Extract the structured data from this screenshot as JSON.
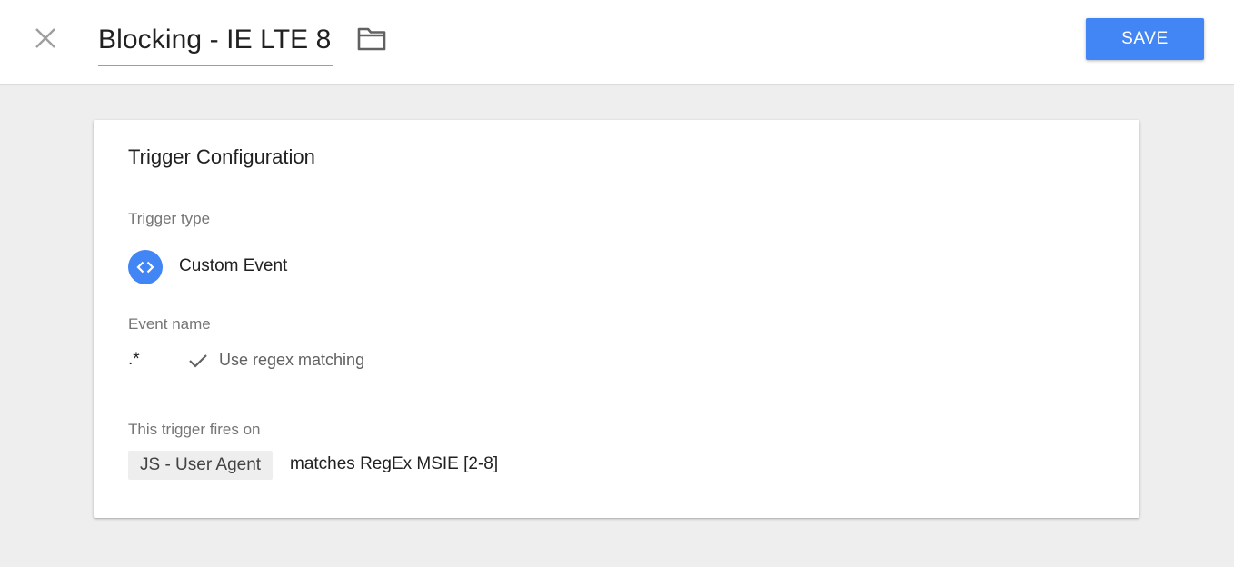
{
  "header": {
    "title": "Blocking - IE LTE 8",
    "save_label": "SAVE",
    "close_icon": "close-icon",
    "folder_icon": "folder-icon",
    "accent_color": "#4285f4"
  },
  "card": {
    "title": "Trigger Configuration",
    "trigger_type": {
      "label": "Trigger type",
      "value": "Custom Event",
      "icon": "code-brackets-icon"
    },
    "event_name": {
      "label": "Event name",
      "value": ".*",
      "regex_label": "Use regex matching",
      "regex_icon": "checkmark-icon"
    },
    "fires_on": {
      "label": "This trigger fires on",
      "variable": "JS - User Agent",
      "condition": "matches RegEx MSIE [2-8]"
    }
  }
}
